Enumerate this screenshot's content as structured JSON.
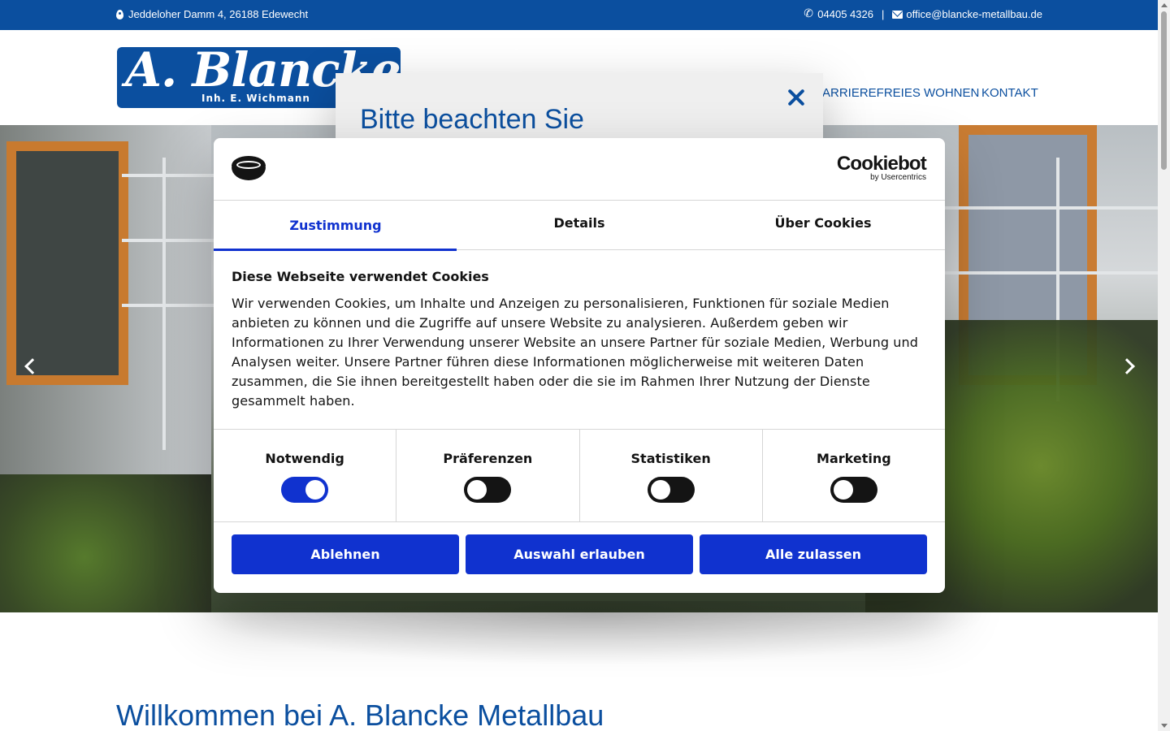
{
  "topbar": {
    "address": "Jeddeloher Damm 4, 26188 Edewecht",
    "phone": "04405 4326",
    "separator": "|",
    "email": "office@blancke-metallbau.de"
  },
  "header": {
    "logo_brand": "A. Blancke",
    "logo_sub": "Inh. E. Wichmann",
    "nav": [
      "ARRIEREFREIES WOHNEN",
      "KONTAKT"
    ]
  },
  "notice": {
    "title": "Bitte beachten Sie"
  },
  "cookie": {
    "brand": "Cookiebot",
    "brand_by": "by Usercentrics",
    "tabs": [
      "Zustimmung",
      "Details",
      "Über Cookies"
    ],
    "active_tab": "Zustimmung",
    "heading": "Diese Webseite verwendet Cookies",
    "text": "Wir verwenden Cookies, um Inhalte und Anzeigen zu personalisieren, Funktionen für soziale Medien anbieten zu können und die Zugriffe auf unsere Website zu analysieren. Außerdem geben wir Informationen zu Ihrer Verwendung unserer Website an unsere Partner für soziale Medien, Werbung und Analysen weiter. Unsere Partner führen diese Informationen möglicherweise mit weiteren Daten zusammen, die Sie ihnen bereitgestellt haben oder die sie im Rahmen Ihrer Nutzung der Dienste gesammelt haben.",
    "categories": [
      {
        "label": "Notwendig",
        "checked": true
      },
      {
        "label": "Präferenzen",
        "checked": false
      },
      {
        "label": "Statistiken",
        "checked": false
      },
      {
        "label": "Marketing",
        "checked": false
      }
    ],
    "buttons": [
      "Ablehnen",
      "Auswahl erlauben",
      "Alle zulassen"
    ],
    "accent_color": "#1032cf"
  },
  "main": {
    "welcome": "Willkommen bei A. Blancke Metallbau"
  },
  "colors": {
    "brand_blue": "#0b4f9f"
  }
}
